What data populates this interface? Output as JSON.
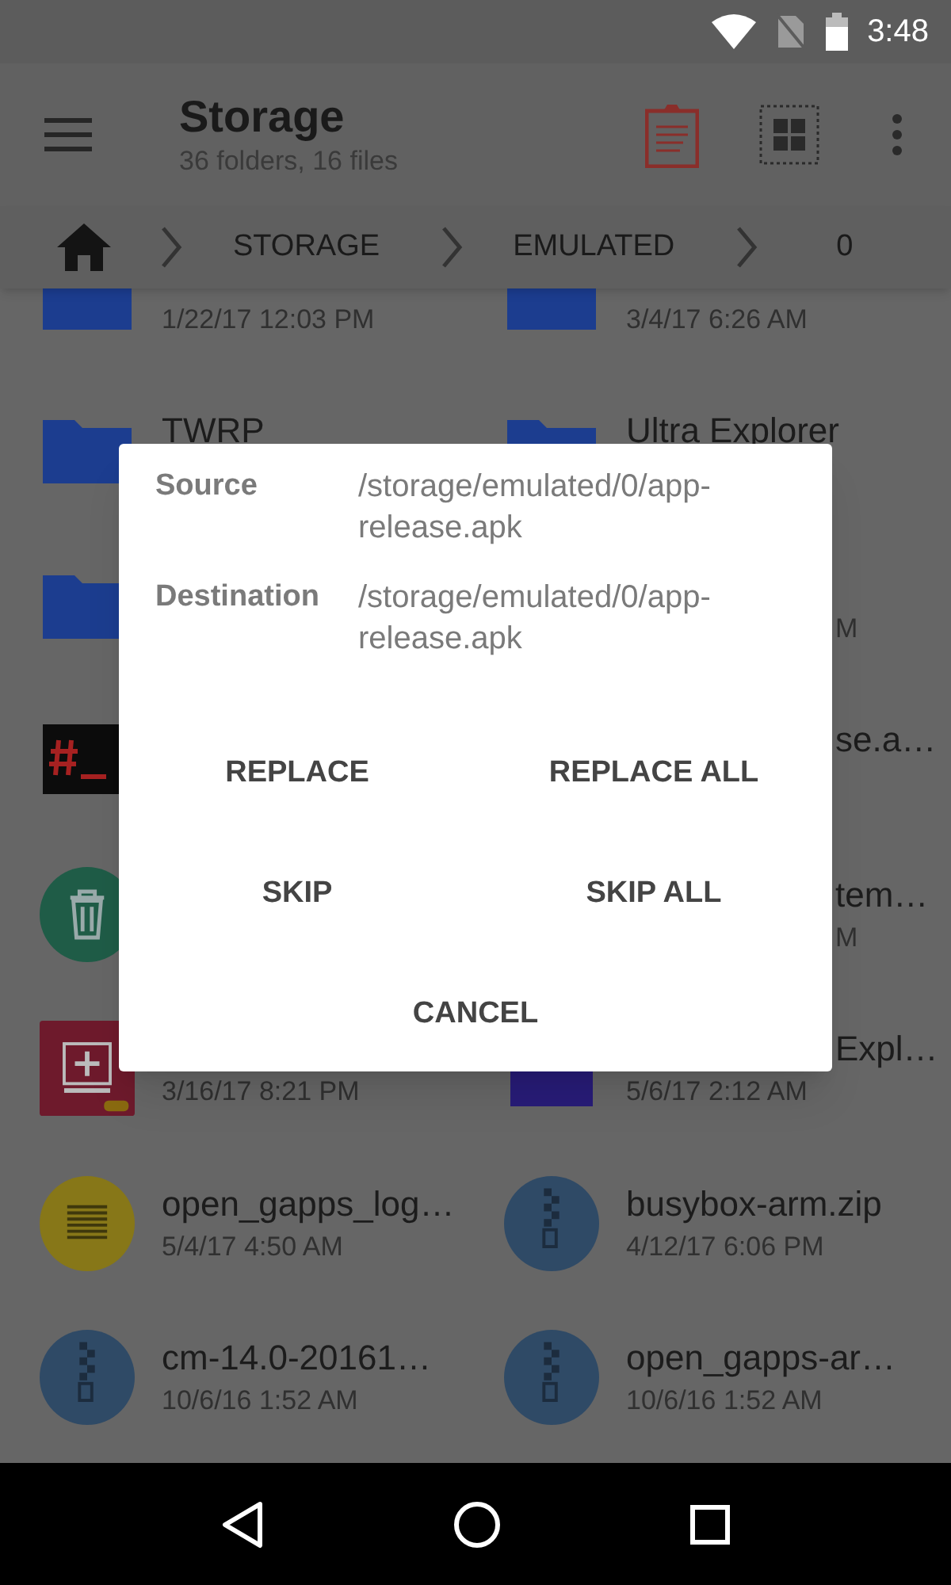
{
  "status_bar": {
    "time": "3:48"
  },
  "app_bar": {
    "title": "Storage",
    "subtitle": "36 folders, 16 files"
  },
  "breadcrumb": [
    {
      "label": "STORAGE"
    },
    {
      "label": "EMULATED"
    },
    {
      "label": "0"
    }
  ],
  "files": [
    {
      "kind": "folder",
      "date": "1/22/17 12:03 PM",
      "date_covered": false
    },
    {
      "kind": "folder",
      "date": "3/4/17 6:26 AM",
      "date_covered": false
    },
    {
      "kind": "folder",
      "name": "TWRP"
    },
    {
      "kind": "folder",
      "name": "Ultra Explorer",
      "name_covered": false
    },
    {
      "kind": "folder"
    },
    {
      "kind": "hidden",
      "date": "M",
      "date_covered": true
    },
    {
      "kind": "terminal"
    },
    {
      "kind": "hidden",
      "name": "se.a…",
      "name_covered": true
    },
    {
      "kind": "trash"
    },
    {
      "kind": "hidden",
      "name": "tem…",
      "name_covered": true,
      "date": "M",
      "date_covered": true
    },
    {
      "kind": "app",
      "date": "3/16/17 8:21 PM",
      "date_covered": false
    },
    {
      "kind": "block",
      "name": "Expl…",
      "name_covered": true,
      "date": "5/6/17 2:12 AM",
      "date_covered": false
    },
    {
      "kind": "text",
      "name": "open_gapps_log…",
      "name_covered": false,
      "date": "5/4/17 4:50 AM",
      "date_covered": false
    },
    {
      "kind": "zip",
      "name": "busybox-arm.zip",
      "name_covered": false,
      "date": "4/12/17 6:06 PM",
      "date_covered": false
    },
    {
      "kind": "zip",
      "name": "cm-14.0-20161…",
      "name_covered": false,
      "date": "10/6/16 1:52 AM",
      "date_covered": false
    },
    {
      "kind": "zip",
      "name": "open_gapps-ar…",
      "name_covered": false,
      "date": "10/6/16 1:52 AM",
      "date_covered": false
    }
  ],
  "dialog": {
    "rows": [
      {
        "label": "Source",
        "value": "/storage/emulated/0/app-release.apk"
      },
      {
        "label": "Destination",
        "value": "/storage/emulated/0/app-release.apk"
      }
    ],
    "buttons": [
      {
        "label": "REPLACE"
      },
      {
        "label": "REPLACE ALL"
      },
      {
        "label": "SKIP"
      },
      {
        "label": "SKIP ALL"
      },
      {
        "label": "CANCEL"
      }
    ]
  }
}
